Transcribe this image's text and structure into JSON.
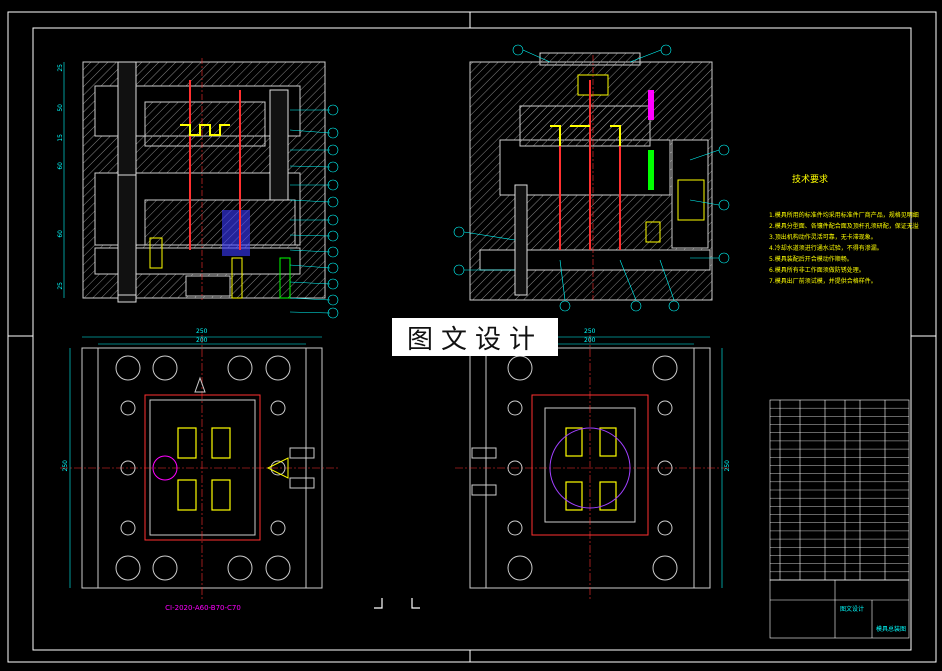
{
  "watermark": "图文设计",
  "technical_requirements": {
    "title": "技术要求",
    "lines": [
      "1.模具所用的标准件均采用标准件厂商产品，规格见明细表。",
      "2.模具分型面、各镶件配合面及顶杆孔须研配，保证无溢料。",
      "3.顶出机构动作灵活可靠，无卡滞现象。",
      "4.冷却水道须进行通水试验，不得有渗漏。",
      "5.模具装配后开合模动作顺畅。",
      "6.模具所有非工作面须做防锈处理。",
      "7.模具出厂前须试模，并提供合格样件。"
    ]
  },
  "mold_code": "CI-2020-A60-B70-C70",
  "dimensions": {
    "front_left_heights": [
      "25",
      "50",
      "15",
      "60",
      "60",
      "25"
    ],
    "plan_left_width_outer": "250",
    "plan_left_width_inner": "200",
    "plan_left_height": "250",
    "plan_right_width_outer": "250",
    "plan_right_width_inner": "200",
    "plan_right_height": "250"
  },
  "colors": {
    "frame": "#ffffff",
    "hatch": "#9a9a9a",
    "cyan": "#00ffff",
    "red": "#ff3030",
    "yellow": "#ffff00",
    "magenta": "#ff00ff",
    "green": "#00ff00"
  },
  "title_block": {
    "company": "图文设计",
    "drawing_name": "模具总装图"
  }
}
